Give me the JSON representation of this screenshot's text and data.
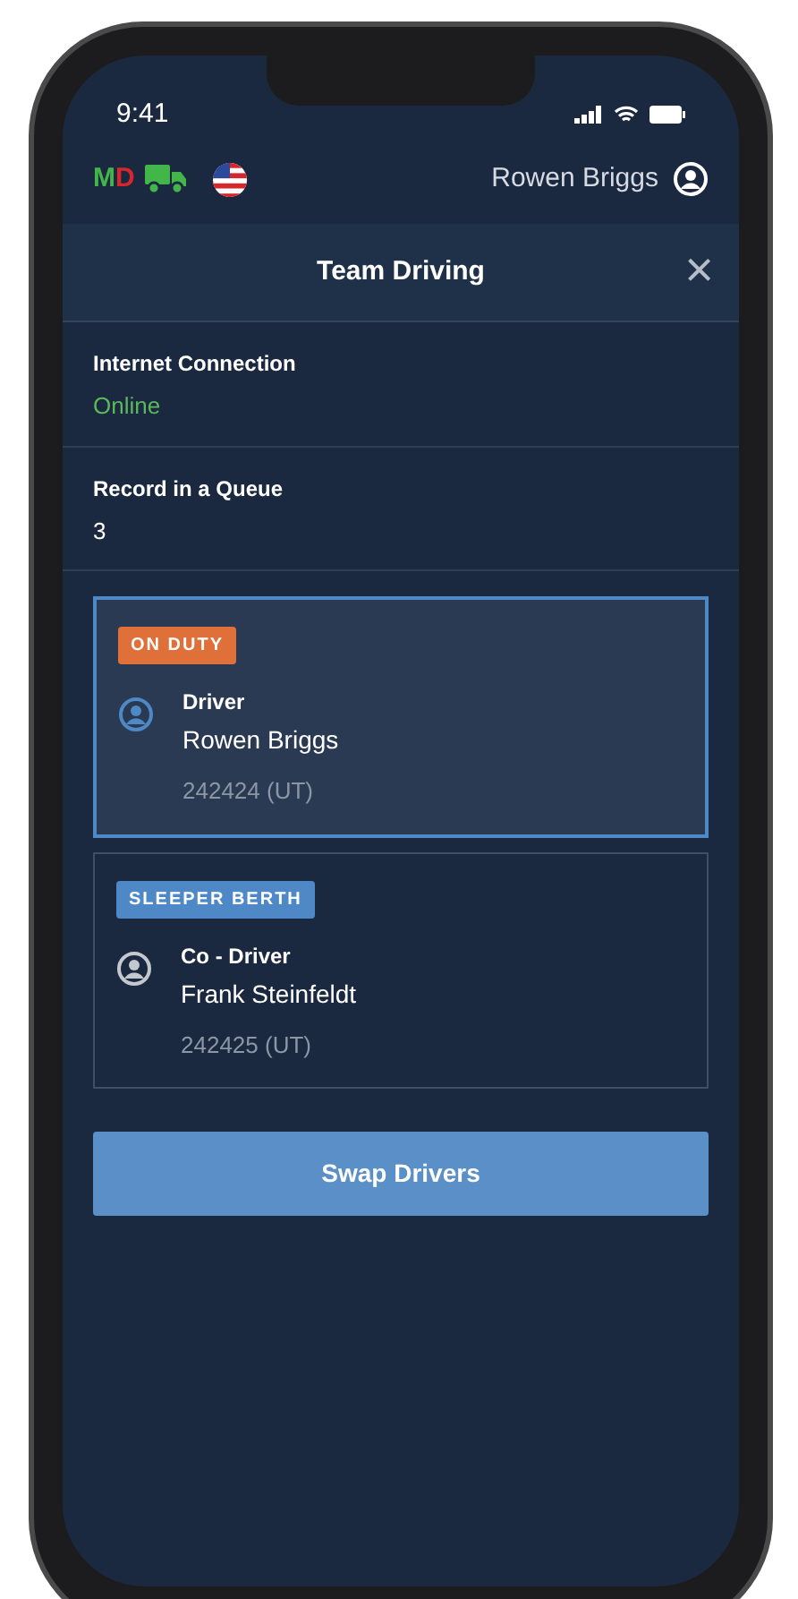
{
  "status_bar": {
    "time": "9:41"
  },
  "app_header": {
    "logo_letters": [
      {
        "text": "M",
        "color": "#43b649"
      },
      {
        "text": "D",
        "color": "#d7262c"
      }
    ],
    "user_name": "Rowen Briggs"
  },
  "dialog": {
    "title": "Team Driving",
    "close": "×"
  },
  "info": [
    {
      "label": "Internet Connection",
      "value": "Online",
      "kind": "status"
    },
    {
      "label": "Record in a Queue",
      "value": "3",
      "kind": "plain"
    }
  ],
  "drivers": [
    {
      "status": "ON DUTY",
      "color": "#e0703a",
      "role": "Driver",
      "name": "Rowen Briggs",
      "id": "242424 (UT)",
      "selected": true
    },
    {
      "status": "SLEEPER BERTH",
      "color": "#4f88c6",
      "role": "Co - Driver",
      "name": "Frank Steinfeldt",
      "id": "242425 (UT)",
      "selected": false
    }
  ],
  "swap_button": "Swap Drivers"
}
